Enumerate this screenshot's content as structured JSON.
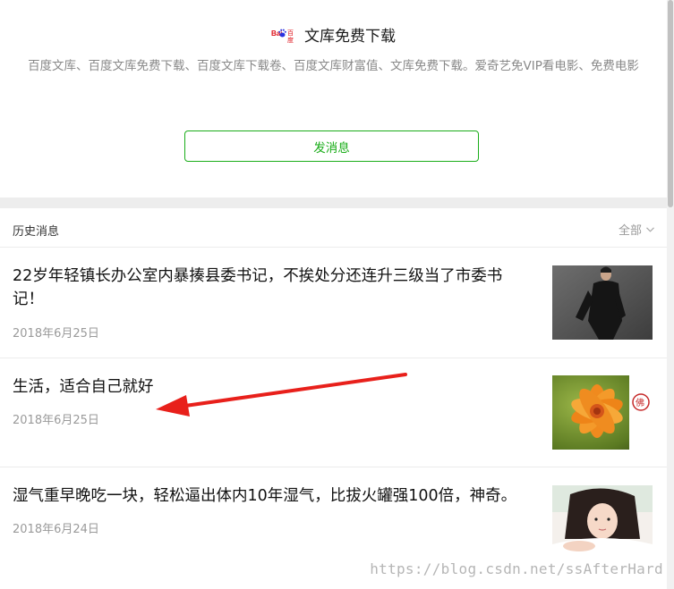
{
  "profile": {
    "logo_icon": "baidu-logo-icon",
    "logo_text": "百度",
    "account_name": "文库免费下载",
    "description": "百度文库、百度文库免费下载、百度文库下载卷、百度文库财富值、文库免费下载。爱奇艺免VIP看电影、免费电影",
    "send_button_label": "发消息"
  },
  "history": {
    "title": "历史消息",
    "filter_label": "全部",
    "filter_icon": "chevron-down-icon",
    "messages": [
      {
        "title": "22岁年轻镇长办公室内暴揍县委书记，不挨处分还连升三级当了市委书记！",
        "date": "2018年6月25日",
        "thumbnail": "man-in-black-suit-photo"
      },
      {
        "title": "生活，适合自己就好",
        "date": "2018年6月25日",
        "thumbnail": "orange-flower-photo"
      },
      {
        "title": "湿气重早晚吃一块，轻松逼出体内10年湿气，比拔火罐强100倍，神奇。",
        "date": "2018年6月24日",
        "thumbnail": "girl-portrait-photo"
      }
    ]
  },
  "annotation": {
    "arrow_icon": "red-arrow-icon",
    "color": "#e8201b"
  },
  "watermark": "https://blog.csdn.net/ssAfterHard",
  "colors": {
    "accent": "#1aad19",
    "background": "#ededed"
  }
}
